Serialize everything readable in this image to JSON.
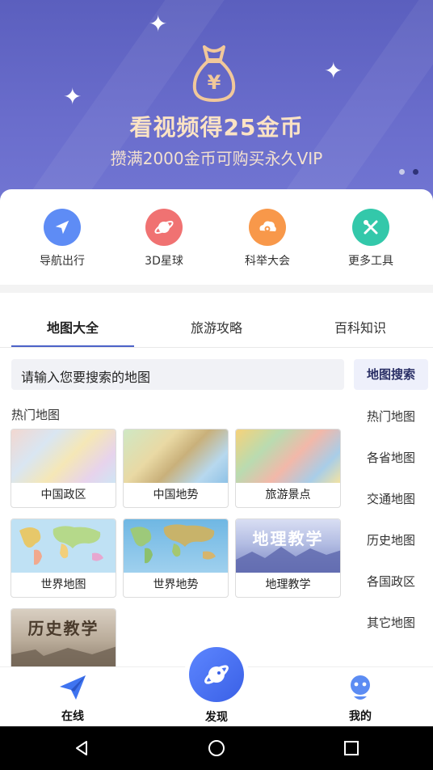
{
  "banner": {
    "title": "看视频得25金币",
    "subtitle": "攒满2000金币可购买永久VIP",
    "currency_symbol": "¥",
    "colors": {
      "bg": "#5b5fbe",
      "gold": "#f1c89a"
    }
  },
  "quick_actions": [
    {
      "label": "导航出行",
      "icon": "navigation-icon",
      "color": "#4d7ff2"
    },
    {
      "label": "3D星球",
      "icon": "planet-icon",
      "color": "#f06a6a"
    },
    {
      "label": "科举大会",
      "icon": "exam-icon",
      "color": "#f7923d"
    },
    {
      "label": "更多工具",
      "icon": "tools-icon",
      "color": "#2fc6a8"
    }
  ],
  "tabs": [
    {
      "label": "地图大全",
      "active": true
    },
    {
      "label": "旅游攻略",
      "active": false
    },
    {
      "label": "百科知识",
      "active": false
    }
  ],
  "search": {
    "placeholder": "请输入您要搜索的地图",
    "button_label": "地图搜索"
  },
  "hot_maps": {
    "title": "热门地图",
    "cards": [
      {
        "label": "中国政区",
        "thumb": "china-political-map"
      },
      {
        "label": "中国地势",
        "thumb": "china-terrain-map"
      },
      {
        "label": "旅游景点",
        "thumb": "tourist-attractions-map"
      },
      {
        "label": "世界地图",
        "thumb": "world-map"
      },
      {
        "label": "世界地势",
        "thumb": "world-terrain-map"
      },
      {
        "label": "地理教学",
        "thumb": "geography-teaching",
        "thumb_text": "地理教学"
      },
      {
        "thumb": "history-teaching",
        "thumb_text": "历史教学"
      }
    ]
  },
  "categories": [
    "热门地图",
    "各省地图",
    "交通地图",
    "历史地图",
    "各国政区",
    "其它地图"
  ],
  "bottom_nav": {
    "items": [
      {
        "label": "在线",
        "icon": "paper-plane-icon"
      },
      {
        "label": "发现",
        "icon": "planet-icon"
      },
      {
        "label": "我的",
        "icon": "profile-icon"
      }
    ]
  },
  "system_nav": {
    "icons": [
      "back-icon",
      "home-icon",
      "recents-icon"
    ]
  },
  "accent_color": "#4c62c8"
}
